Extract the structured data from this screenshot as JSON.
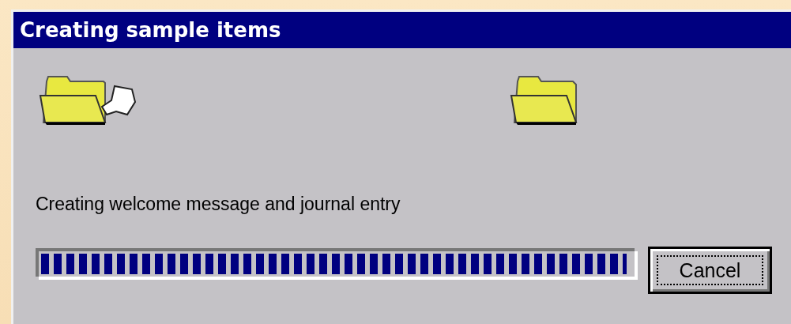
{
  "window": {
    "title": "Creating sample items"
  },
  "status": {
    "text": "Creating welcome message and journal entry"
  },
  "progress": {
    "level": 0.99
  },
  "buttons": [
    {
      "label": "Cancel",
      "focused": true
    }
  ]
}
